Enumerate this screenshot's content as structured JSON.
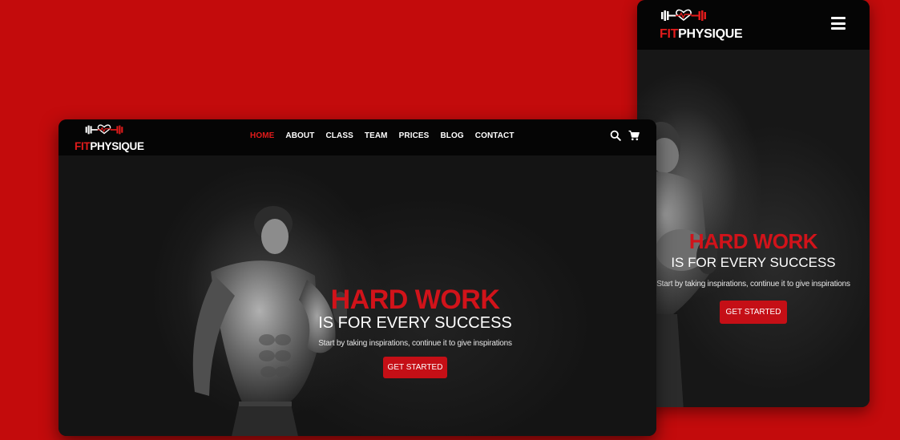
{
  "brand": {
    "fit": "FIT",
    "physique": "PHYSIQUE"
  },
  "desktop": {
    "nav": [
      "HOME",
      "ABOUT",
      "CLASS",
      "TEAM",
      "PRICES",
      "BLOG",
      "CONTACT"
    ],
    "active_nav": "HOME",
    "icons": [
      "search-icon",
      "cart-icon"
    ]
  },
  "mobile": {
    "icons": [
      "hamburger-menu-icon"
    ]
  },
  "hero": {
    "title": "HARD WORK",
    "subtitle": "IS FOR EVERY SUCCESS",
    "description": "Start by taking inspirations, continue it to give inspirations",
    "cta_label": "GET STARTED"
  },
  "colors": {
    "background": "#c30b0c",
    "accent": "#d1131a",
    "header": "#050505",
    "hero_bg": "#141414"
  }
}
